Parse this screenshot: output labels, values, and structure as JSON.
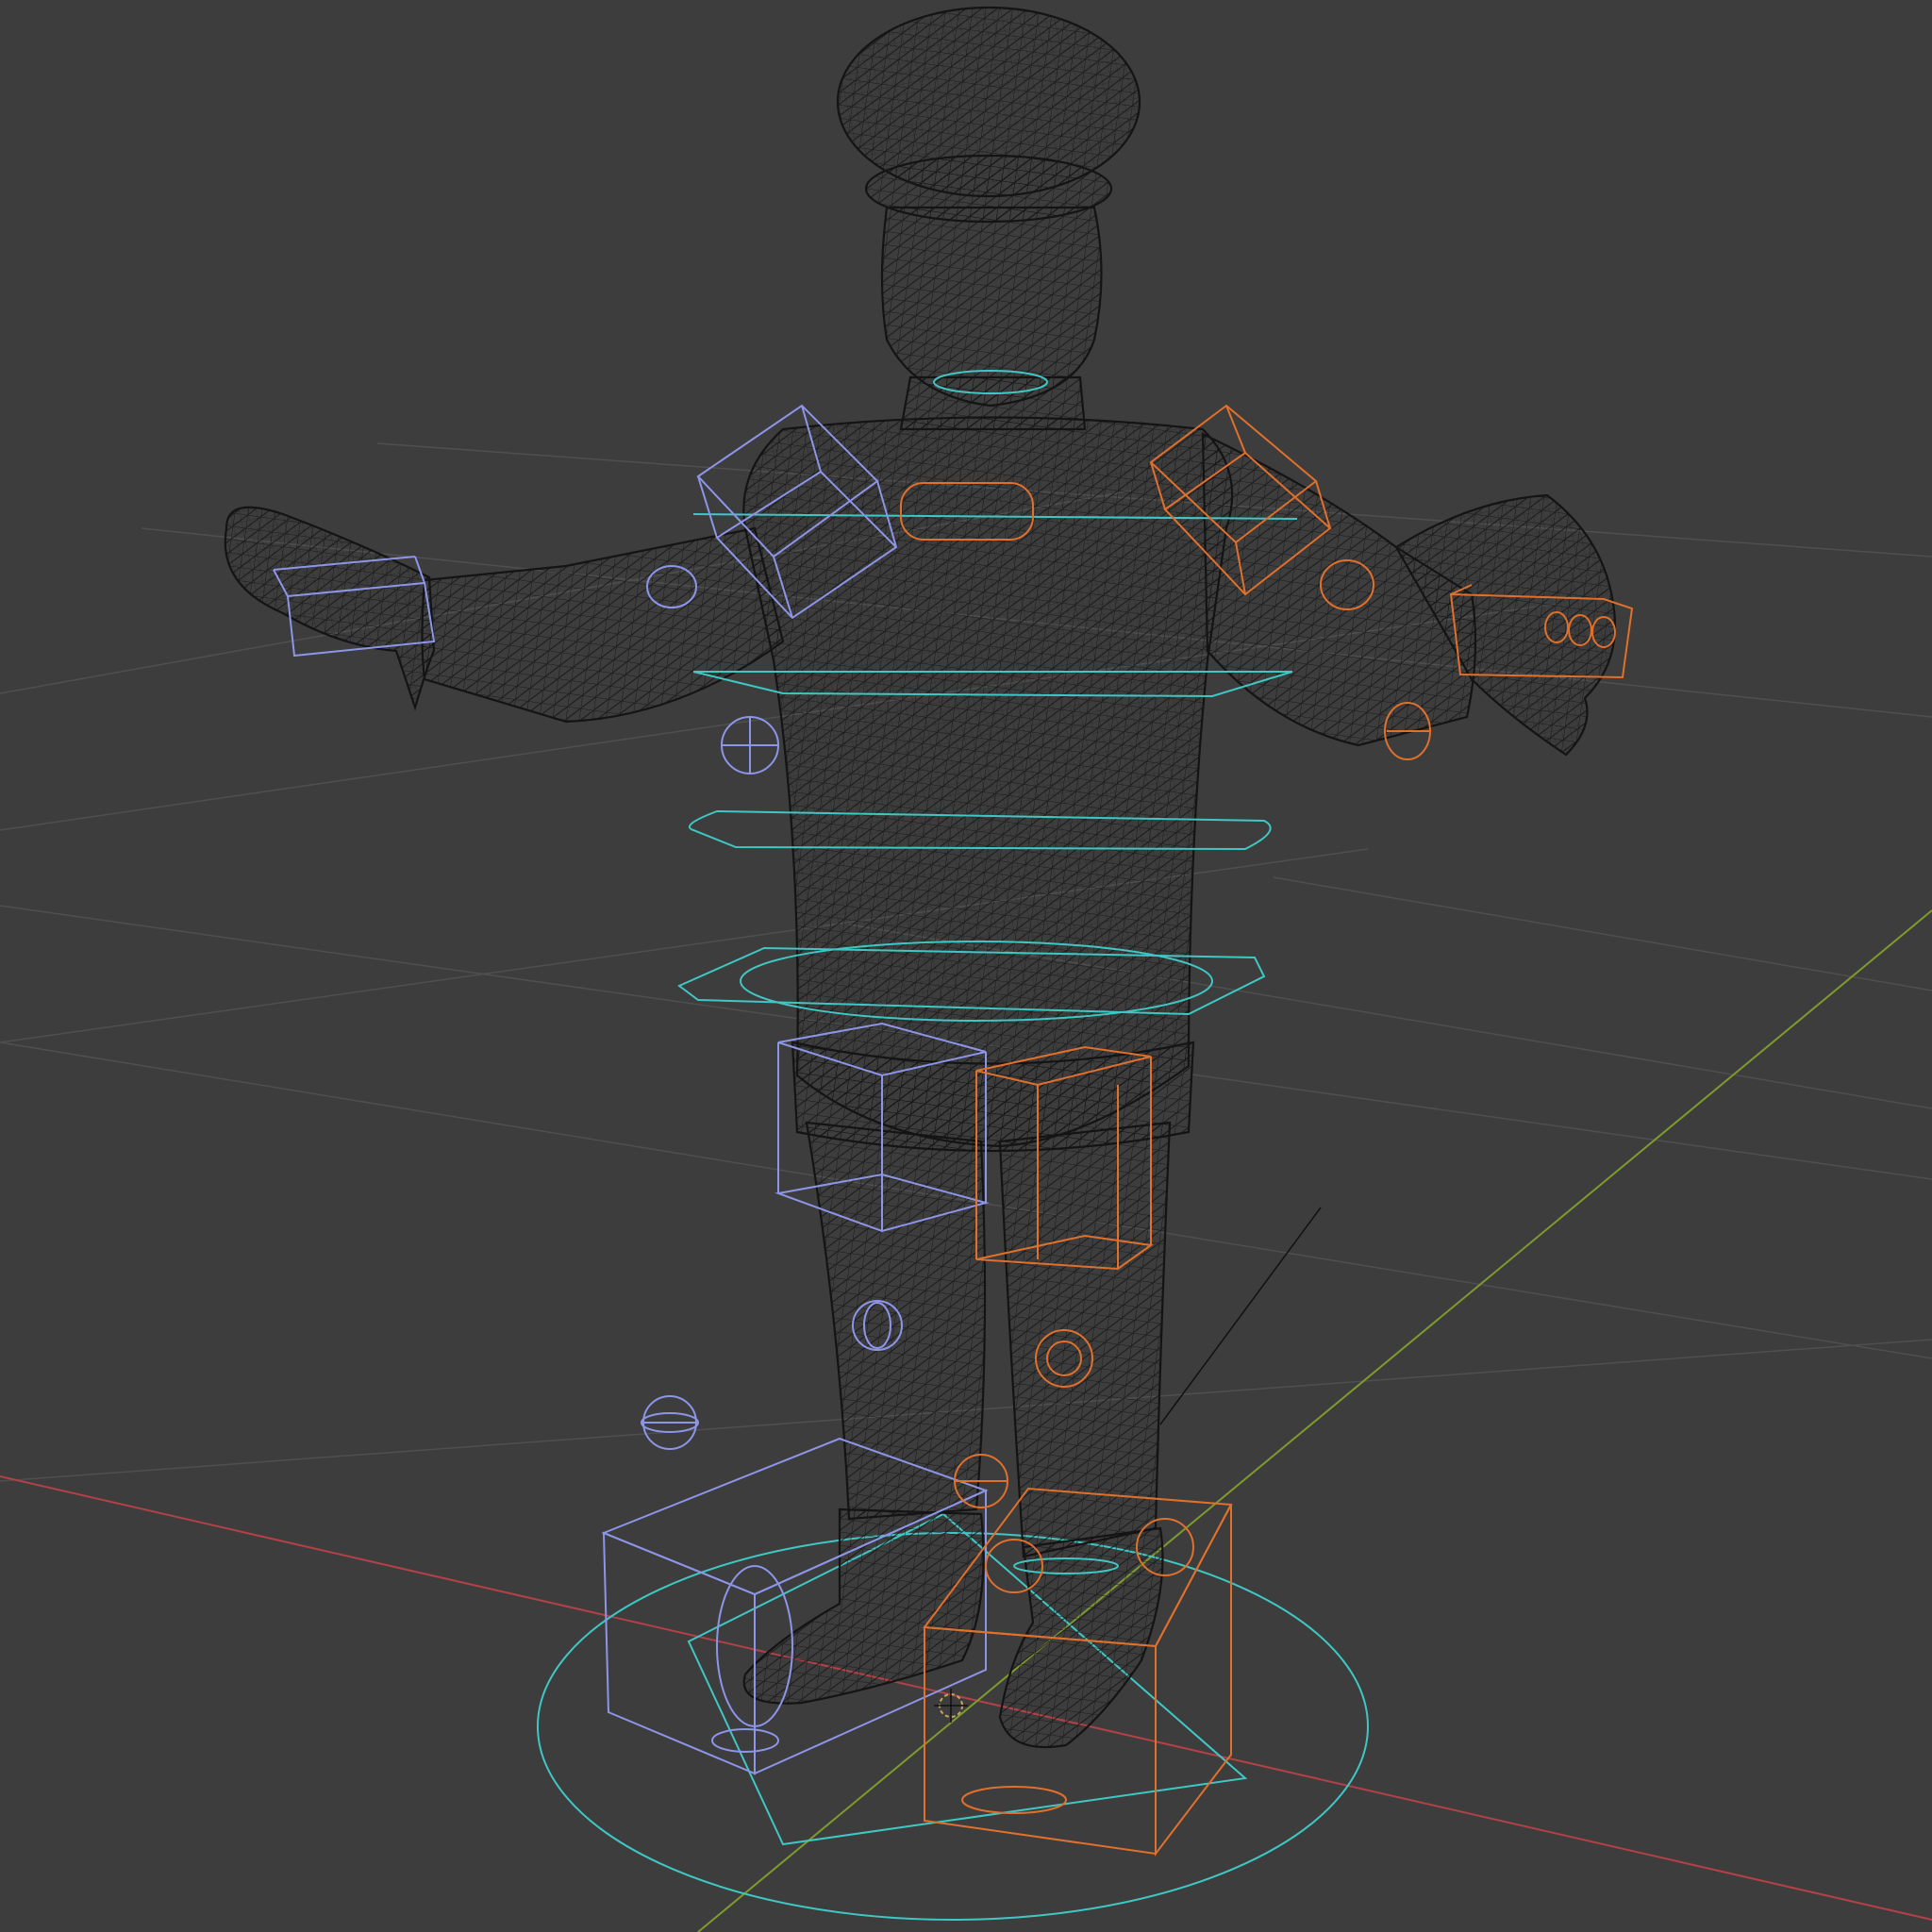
{
  "viewport": {
    "mode": "wireframe",
    "background": "#3d3d3d",
    "colors": {
      "grid": "#4f4f4f",
      "axis_x": "#b24148",
      "axis_y": "#7e9a2e",
      "mesh": "#141414",
      "control_center": "#3fc7c4",
      "control_left": "#8d95e8",
      "control_right": "#e0702c",
      "view_line": "#111111"
    },
    "objects": [
      "character-mesh",
      "rig-controls",
      "root-control",
      "3d-cursor"
    ]
  }
}
